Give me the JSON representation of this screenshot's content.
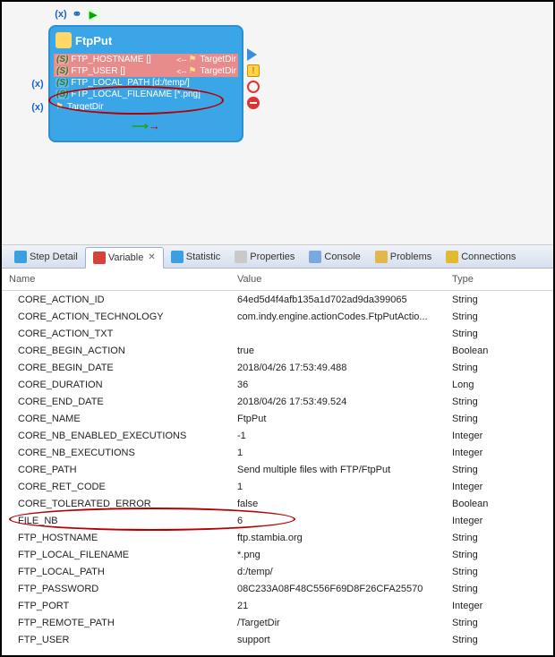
{
  "node": {
    "title": "FtpPut",
    "params": [
      {
        "badge": "(S)",
        "name": "FTP_HOSTNAME []",
        "arrow": "<--",
        "target": "TargetDir",
        "red": true
      },
      {
        "badge": "(S)",
        "name": "FTP_USER []",
        "arrow": "<--",
        "target": "TargetDir",
        "red": true
      },
      {
        "badge": "(S)",
        "name": "FTP_LOCAL_PATH [d:/temp/]",
        "arrow": "",
        "target": "",
        "red": false
      },
      {
        "badge": "(S)",
        "name": "FTP_LOCAL_FILENAME [*.png]",
        "arrow": "",
        "target": "",
        "red": false
      }
    ],
    "footer_target": "TargetDir"
  },
  "tabs": [
    {
      "label": "Step Detail",
      "icon": "#3aa0e2"
    },
    {
      "label": "Variable",
      "icon": "#d6423a",
      "active": true
    },
    {
      "label": "Statistic",
      "icon": "#3aa0e2"
    },
    {
      "label": "Properties",
      "icon": "#c9c9c9"
    },
    {
      "label": "Console",
      "icon": "#7aa9e2"
    },
    {
      "label": "Problems",
      "icon": "#e2b84a"
    },
    {
      "label": "Connections",
      "icon": "#e2ba32"
    }
  ],
  "table": {
    "headers": [
      "Name",
      "Value",
      "Type"
    ],
    "rows": [
      {
        "name": "CORE_ACTION_ID",
        "value": "64ed5d4f4afb135a1d702ad9da399065",
        "type": "String"
      },
      {
        "name": "CORE_ACTION_TECHNOLOGY",
        "value": "com.indy.engine.actionCodes.FtpPutActio...",
        "type": "String"
      },
      {
        "name": "CORE_ACTION_TXT",
        "value": "",
        "type": "String"
      },
      {
        "name": "CORE_BEGIN_ACTION",
        "value": "true",
        "type": "Boolean"
      },
      {
        "name": "CORE_BEGIN_DATE",
        "value": "2018/04/26 17:53:49.488",
        "type": "String"
      },
      {
        "name": "CORE_DURATION",
        "value": "36",
        "type": "Long"
      },
      {
        "name": "CORE_END_DATE",
        "value": "2018/04/26 17:53:49.524",
        "type": "String"
      },
      {
        "name": "CORE_NAME",
        "value": "FtpPut",
        "type": "String"
      },
      {
        "name": "CORE_NB_ENABLED_EXECUTIONS",
        "value": "-1",
        "type": "Integer"
      },
      {
        "name": "CORE_NB_EXECUTIONS",
        "value": "1",
        "type": "Integer"
      },
      {
        "name": "CORE_PATH",
        "value": "Send multiple files with FTP/FtpPut",
        "type": "String"
      },
      {
        "name": "CORE_RET_CODE",
        "value": "1",
        "type": "Integer"
      },
      {
        "name": "CORE_TOLERATED_ERROR",
        "value": "false",
        "type": "Boolean"
      },
      {
        "name": "FILE_NB",
        "value": "6",
        "type": "Integer"
      },
      {
        "name": "FTP_HOSTNAME",
        "value": "ftp.stambia.org",
        "type": "String"
      },
      {
        "name": "FTP_LOCAL_FILENAME",
        "value": "*.png",
        "type": "String"
      },
      {
        "name": "FTP_LOCAL_PATH",
        "value": "d:/temp/",
        "type": "String"
      },
      {
        "name": "FTP_PASSWORD",
        "value": "08C233A08F48C556F69D8F26CFA25570",
        "type": "String"
      },
      {
        "name": "FTP_PORT",
        "value": "21",
        "type": "Integer"
      },
      {
        "name": "FTP_REMOTE_PATH",
        "value": "/TargetDir",
        "type": "String"
      },
      {
        "name": "FTP_USER",
        "value": "support",
        "type": "String"
      }
    ],
    "highlight_row_index": 13
  }
}
